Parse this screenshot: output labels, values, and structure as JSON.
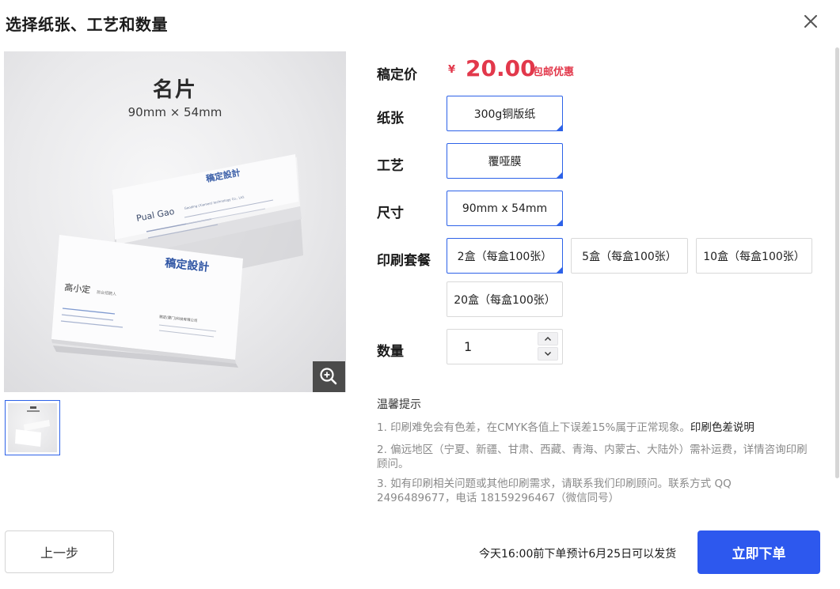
{
  "dialog": {
    "title": "选择纸张、工艺和数量"
  },
  "preview": {
    "product_name": "名片",
    "product_size": "90mm × 54mm",
    "front_card": {
      "brand": "稿定設計",
      "person": "高小定",
      "role": "前台招聘人",
      "company": "稿定(厦门)科技有限公司"
    },
    "back_card": {
      "brand": "稿定設計",
      "person": "Pual Gao",
      "company": "Gaoding (Xiamen) technology Co., Ltd."
    }
  },
  "price": {
    "label": "稿定价",
    "currency": "¥",
    "amount": "20.00",
    "tag": "包邮优惠"
  },
  "options": {
    "paper": {
      "label": "纸张",
      "choices": [
        "300g铜版纸"
      ],
      "selected": "300g铜版纸"
    },
    "craft": {
      "label": "工艺",
      "choices": [
        "覆哑膜"
      ],
      "selected": "覆哑膜"
    },
    "size": {
      "label": "尺寸",
      "choices": [
        "90mm x 54mm"
      ],
      "selected": "90mm x 54mm"
    },
    "package": {
      "label": "印刷套餐",
      "choices": [
        "2盒（每盒100张）",
        "5盒（每盒100张）",
        "10盒（每盒100张）",
        "20盒（每盒100张）"
      ],
      "selected": "2盒（每盒100张）"
    }
  },
  "quantity": {
    "label": "数量",
    "value": "1"
  },
  "tips": {
    "title": "温馨提示",
    "items": [
      "1. 印刷难免会有色差，在CMYK各值上下误差15%属于正常现象。",
      "2. 偏远地区（宁夏、新疆、甘肃、西藏、青海、内蒙古、大陆外）需补运费，详情咨询印刷顾问。",
      "3. 如有印刷相关问题或其他印刷需求，请联系我们印刷顾问。联系方式 QQ 2496489677，电话 18159296467（微信同号）"
    ],
    "color_link": "印刷色差说明"
  },
  "footer": {
    "prev_label": "上一步",
    "ship_note": "今天16:00前下单预计6月25日可以发货",
    "order_label": "立即下单"
  },
  "colors": {
    "accent": "#2d58ee",
    "price": "#e2384b",
    "border": "#d9d9d9"
  }
}
